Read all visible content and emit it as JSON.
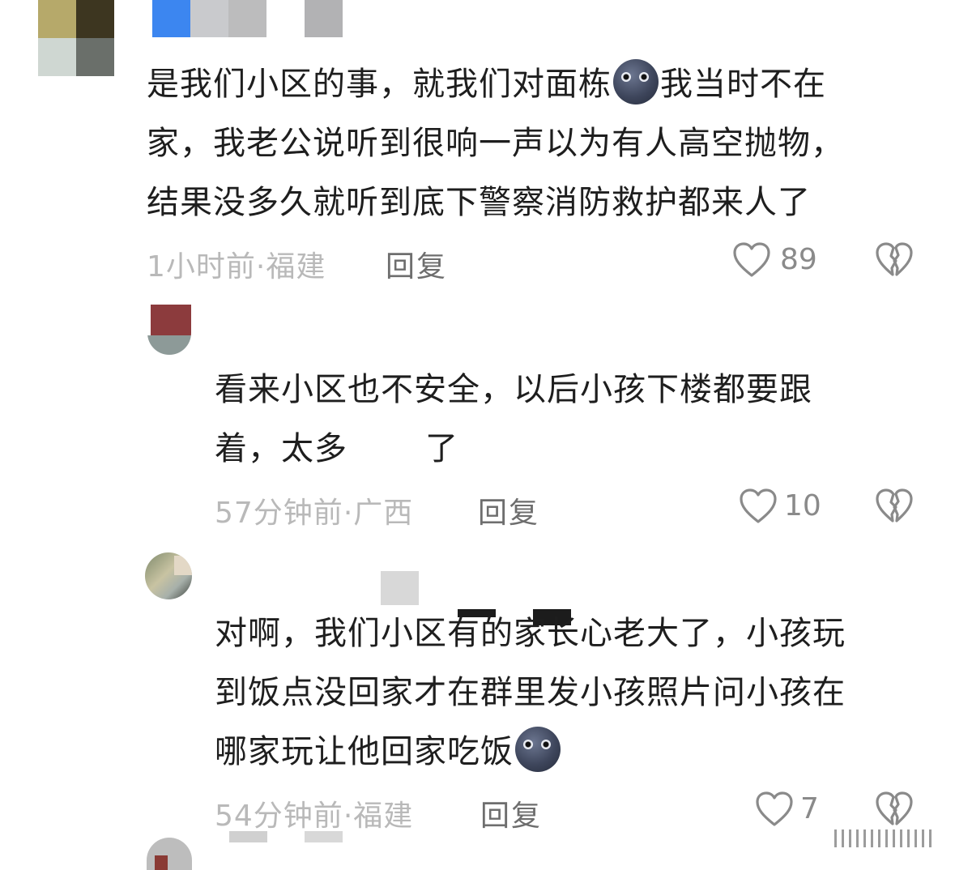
{
  "comments": [
    {
      "name": "",
      "text_lines": [
        "是我们小区的事，就我们对面栋",
        "我当时不在",
        "家，我老公说听到很响一声以为有人高空抛物，",
        "结果没多久就听到底下警察消防救护都来人了"
      ],
      "time": "1小时前",
      "location": "福建",
      "reply_label": "回复",
      "likes": "89",
      "emoji": "new-moon-face"
    },
    {
      "name": "",
      "text_lines": [
        "看来小区也不安全，以后小孩下楼都要跟",
        "着，太多",
        "了"
      ],
      "time": "57分钟前",
      "location": "广西",
      "reply_label": "回复",
      "likes": "10"
    },
    {
      "name": "",
      "text_lines": [
        "对啊，我们小区有的家长心老大了，小孩玩",
        "到饭点没回家才在群里发小孩照片问小孩在",
        "哪家玩让他回家吃饭"
      ],
      "time": "54分钟前",
      "location": "福建",
      "reply_label": "回复",
      "likes": "7",
      "emoji": "new-moon-face"
    }
  ],
  "separator": "·",
  "icons": {
    "like": "heart-outline-icon",
    "dislike": "broken-heart-icon"
  },
  "colors": {
    "meta": "#b9b9b9",
    "reply": "#6e6e6e",
    "icon": "#8a8a8a"
  }
}
